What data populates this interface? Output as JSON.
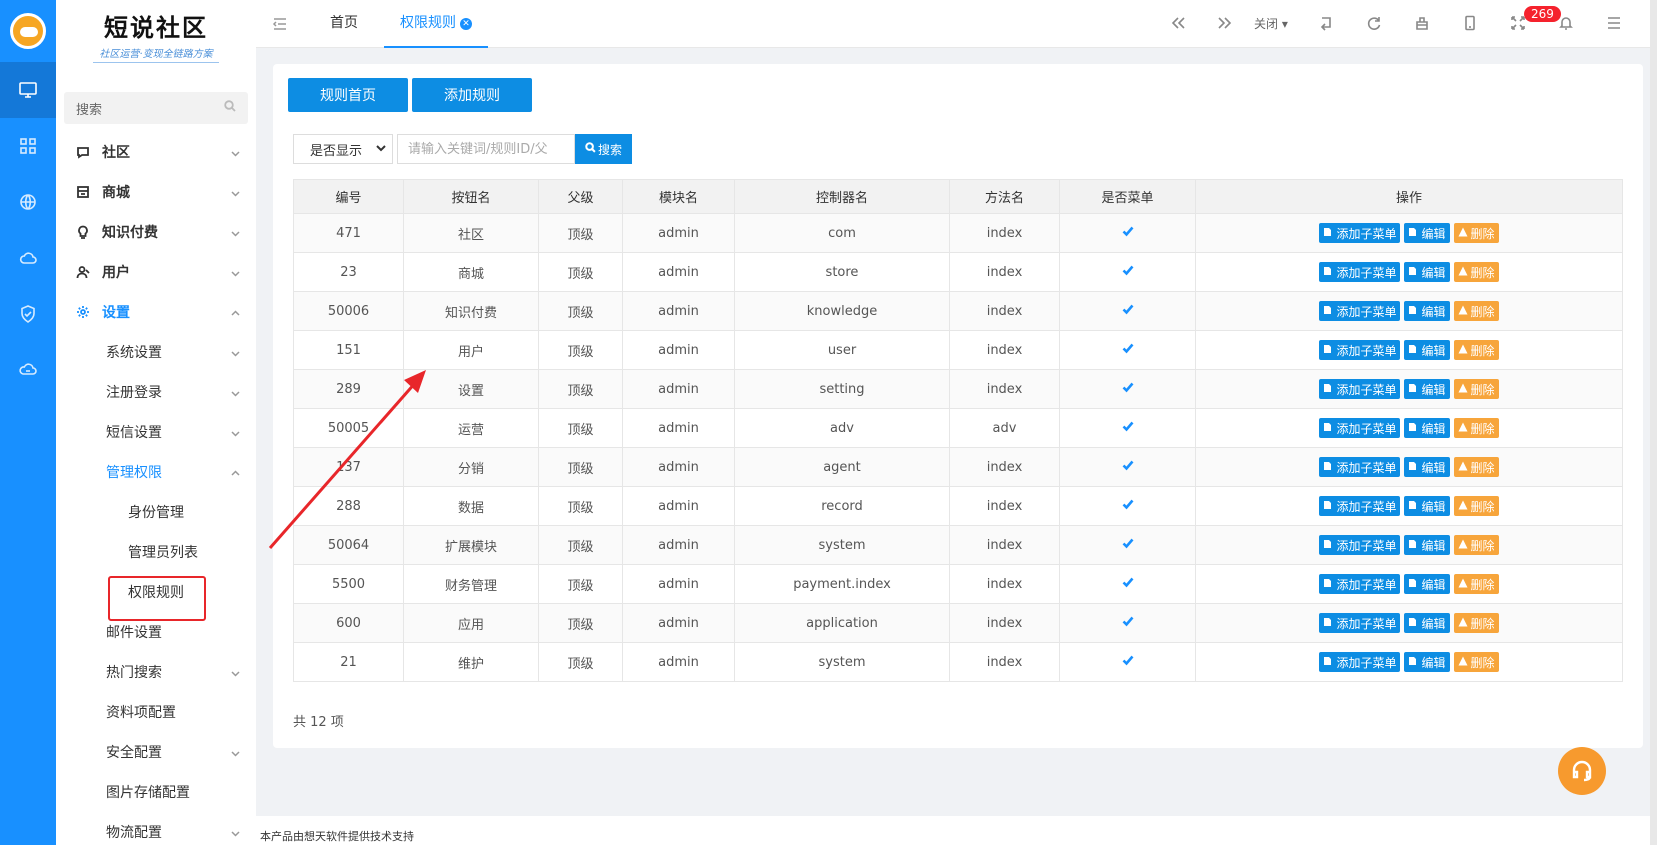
{
  "brand": {
    "name": "短说社区",
    "slogan": "社区运营·变现全链路方案"
  },
  "sidebar": {
    "search_placeholder": "搜索",
    "items": [
      {
        "label": "社区",
        "icon": "chat-icon"
      },
      {
        "label": "商城",
        "icon": "store-icon"
      },
      {
        "label": "知识付费",
        "icon": "bulb-icon"
      },
      {
        "label": "用户",
        "icon": "user-icon"
      },
      {
        "label": "设置",
        "icon": "gear-icon"
      }
    ],
    "settings_children": [
      "系统设置",
      "注册登录",
      "短信设置",
      "管理权限",
      "邮件设置",
      "热门搜索",
      "资料项配置",
      "安全配置",
      "图片存储配置",
      "物流配置"
    ],
    "permission_children": [
      "身份管理",
      "管理员列表",
      "权限规则"
    ]
  },
  "tabs": [
    {
      "label": "首页"
    },
    {
      "label": "权限规则"
    }
  ],
  "toolbar": {
    "close_label": "关闭",
    "notification_count": "269"
  },
  "buttons": {
    "rules_home": "规则首页",
    "add_rule": "添加规则"
  },
  "filter": {
    "select_value": "是否显示",
    "keyword_placeholder": "请输入关键词/规则ID/父",
    "search_label": "搜索"
  },
  "table": {
    "columns": [
      "编号",
      "按钮名",
      "父级",
      "模块名",
      "控制器名",
      "方法名",
      "是否菜单",
      "操作"
    ],
    "rows": [
      [
        "471",
        "社区",
        "顶级",
        "admin",
        "com",
        "index"
      ],
      [
        "23",
        "商城",
        "顶级",
        "admin",
        "store",
        "index"
      ],
      [
        "50006",
        "知识付费",
        "顶级",
        "admin",
        "knowledge",
        "index"
      ],
      [
        "151",
        "用户",
        "顶级",
        "admin",
        "user",
        "index"
      ],
      [
        "289",
        "设置",
        "顶级",
        "admin",
        "setting",
        "index"
      ],
      [
        "50005",
        "运营",
        "顶级",
        "admin",
        "adv",
        "adv"
      ],
      [
        "137",
        "分销",
        "顶级",
        "admin",
        "agent",
        "index"
      ],
      [
        "288",
        "数据",
        "顶级",
        "admin",
        "record",
        "index"
      ],
      [
        "50064",
        "扩展模块",
        "顶级",
        "admin",
        "system",
        "index"
      ],
      [
        "5500",
        "财务管理",
        "顶级",
        "admin",
        "payment.index",
        "index"
      ],
      [
        "600",
        "应用",
        "顶级",
        "admin",
        "application",
        "index"
      ],
      [
        "21",
        "维护",
        "顶级",
        "admin",
        "system",
        "index"
      ]
    ],
    "actions": {
      "add_child": "添加子菜单",
      "edit": "编辑",
      "delete": "删除"
    }
  },
  "total_text": "共 12 项",
  "footer_text": "本产品由想天软件提供技术支持",
  "colors": {
    "primary": "#0d8de3",
    "warning": "#f7a53b",
    "rail": "#1890ff",
    "annotation": "#e8262a"
  }
}
